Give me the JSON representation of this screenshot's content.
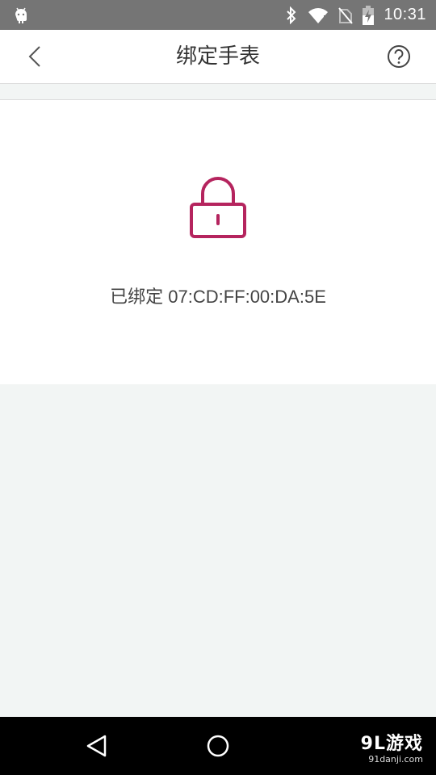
{
  "status_bar": {
    "time": "10:31",
    "icons": [
      "android-icon",
      "bluetooth-icon",
      "wifi-icon",
      "no-sim-icon",
      "battery-charging-icon"
    ]
  },
  "header": {
    "title": "绑定手表",
    "back_icon": "chevron-left-icon",
    "help_icon": "help-circle-icon"
  },
  "bind_card": {
    "icon": "lock-icon",
    "status_text": "已绑定 07:CD:FF:00:DA:5E"
  },
  "nav_bar": {
    "icons": [
      "back-triangle-icon",
      "home-circle-icon"
    ],
    "watermark_main": "9L游戏",
    "watermark_sub": "91danji.com"
  },
  "colors": {
    "accent": "#b5245e",
    "status_bar": "#757575",
    "background": "#f2f5f4"
  }
}
